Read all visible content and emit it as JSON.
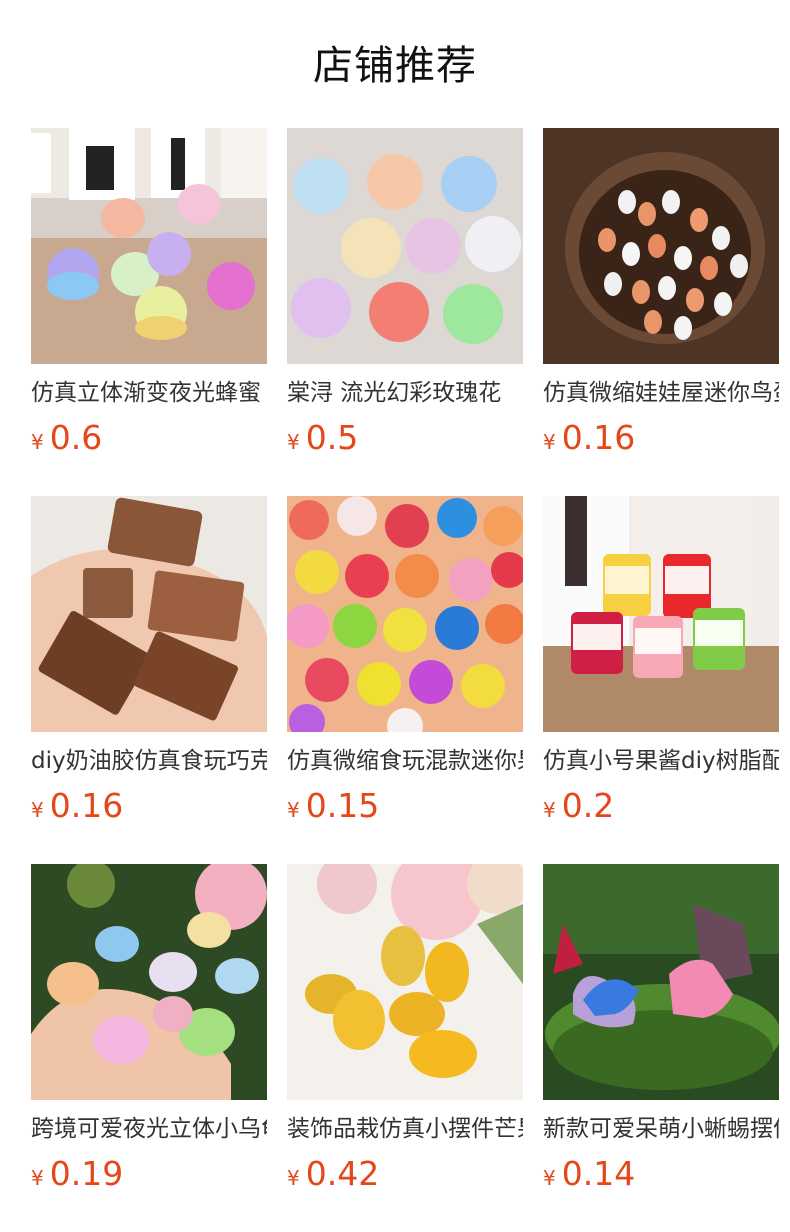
{
  "header": {
    "title": "店铺推荐"
  },
  "products": [
    {
      "name": "仿真立体渐变夜光蜂蜜",
      "currency": "¥",
      "price": "0.6",
      "icon": "honey-jar-photo"
    },
    {
      "name": "棠浔 流光幻彩玫瑰花",
      "currency": "¥",
      "price": "0.5",
      "icon": "rose-charm-photo"
    },
    {
      "name": "仿真微缩娃娃屋迷你鸟蛋",
      "currency": "¥",
      "price": "0.16",
      "icon": "bird-egg-nest-photo"
    },
    {
      "name": "diy奶油胶仿真食玩巧克力",
      "currency": "¥",
      "price": "0.16",
      "icon": "chocolate-bar-photo"
    },
    {
      "name": "仿真微缩食玩混款迷你果冻",
      "currency": "¥",
      "price": "0.15",
      "icon": "jelly-pudding-photo"
    },
    {
      "name": "仿真小号果酱diy树脂配件",
      "currency": "¥",
      "price": "0.2",
      "icon": "jam-jar-photo"
    },
    {
      "name": "跨境可爱夜光立体小乌龟",
      "currency": "¥",
      "price": "0.19",
      "icon": "glow-turtle-photo"
    },
    {
      "name": "装饰品栽仿真小摆件芒果",
      "currency": "¥",
      "price": "0.42",
      "icon": "mango-photo"
    },
    {
      "name": "新款可爱呆萌小蜥蜴摆件",
      "currency": "¥",
      "price": "0.14",
      "icon": "lizard-figure-photo"
    }
  ]
}
